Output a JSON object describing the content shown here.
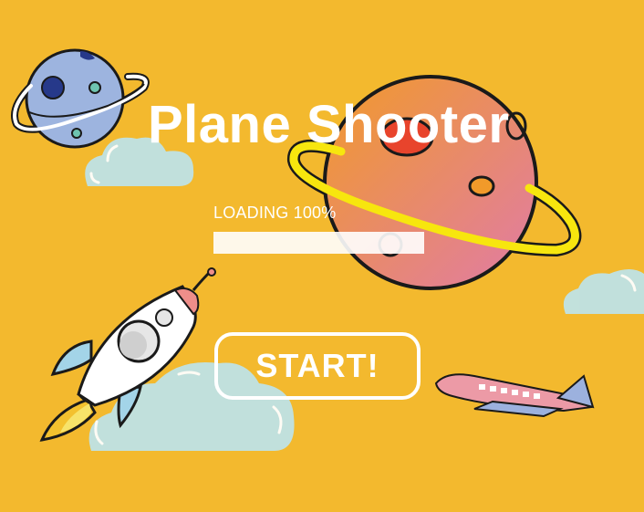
{
  "game": {
    "title": "Plane Shooter",
    "background_color": "#F3B92E",
    "accent_color": "#FFFFFF"
  },
  "loading": {
    "label": "LOADING 100%",
    "progress_fraction": 1.0
  },
  "start_button": {
    "label": "START!"
  },
  "decorations": {
    "icons": [
      "blue-planet-icon",
      "orange-planet-icon",
      "rocket-icon",
      "airplane-icon",
      "cloud-icon"
    ]
  }
}
